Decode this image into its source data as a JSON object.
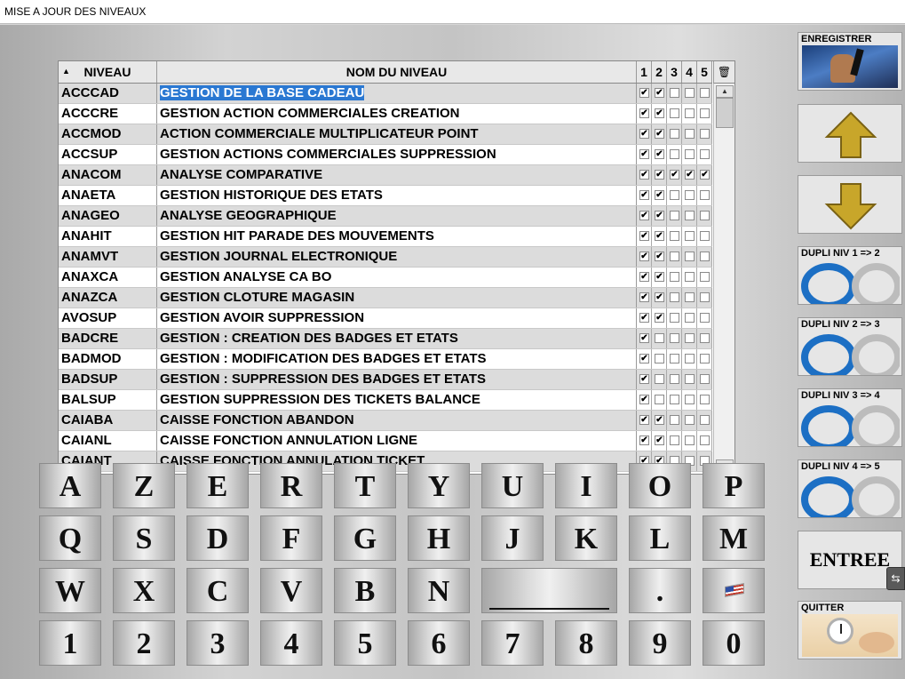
{
  "window": {
    "title": "MISE A JOUR DES NIVEAUX"
  },
  "grid": {
    "headers": {
      "code": "NIVEAU",
      "name": "NOM DU NIVEAU",
      "levels": [
        "1",
        "2",
        "3",
        "4",
        "5"
      ]
    },
    "rows": [
      {
        "code": "ACCCAD",
        "name": "GESTION DE LA BASE CADEAU",
        "checks": [
          true,
          true,
          false,
          false,
          false
        ],
        "selected": true
      },
      {
        "code": "ACCCRE",
        "name": "GESTION ACTION COMMERCIALES  CREATION",
        "checks": [
          true,
          true,
          false,
          false,
          false
        ]
      },
      {
        "code": "ACCMOD",
        "name": "ACTION COMMERCIALE MULTIPLICATEUR POINT",
        "checks": [
          true,
          true,
          false,
          false,
          false
        ]
      },
      {
        "code": "ACCSUP",
        "name": "GESTION ACTIONS COMMERCIALES SUPPRESSION",
        "checks": [
          true,
          true,
          false,
          false,
          false
        ]
      },
      {
        "code": "ANACOM",
        "name": "ANALYSE COMPARATIVE",
        "checks": [
          true,
          true,
          true,
          true,
          true
        ]
      },
      {
        "code": "ANAETA",
        "name": "GESTION HISTORIQUE DES ETATS",
        "checks": [
          true,
          true,
          false,
          false,
          false
        ]
      },
      {
        "code": "ANAGEO",
        "name": "ANALYSE GEOGRAPHIQUE",
        "checks": [
          true,
          true,
          false,
          false,
          false
        ]
      },
      {
        "code": "ANAHIT",
        "name": "GESTION HIT PARADE DES MOUVEMENTS",
        "checks": [
          true,
          true,
          false,
          false,
          false
        ]
      },
      {
        "code": "ANAMVT",
        "name": "GESTION JOURNAL ELECTRONIQUE",
        "checks": [
          true,
          true,
          false,
          false,
          false
        ]
      },
      {
        "code": "ANAXCA",
        "name": "GESTION ANALYSE CA BO",
        "checks": [
          true,
          true,
          false,
          false,
          false
        ]
      },
      {
        "code": "ANAZCA",
        "name": "GESTION CLOTURE MAGASIN",
        "checks": [
          true,
          true,
          false,
          false,
          false
        ]
      },
      {
        "code": "AVOSUP",
        "name": "GESTION AVOIR SUPPRESSION",
        "checks": [
          true,
          true,
          false,
          false,
          false
        ]
      },
      {
        "code": "BADCRE",
        "name": "GESTION : CREATION DES BADGES ET ETATS",
        "checks": [
          true,
          false,
          false,
          false,
          false
        ]
      },
      {
        "code": "BADMOD",
        "name": "GESTION : MODIFICATION DES BADGES ET ETATS",
        "checks": [
          true,
          false,
          false,
          false,
          false
        ]
      },
      {
        "code": "BADSUP",
        "name": "GESTION : SUPPRESSION DES BADGES ET ETATS",
        "checks": [
          true,
          false,
          false,
          false,
          false
        ]
      },
      {
        "code": "BALSUP",
        "name": "GESTION SUPPRESSION DES TICKETS BALANCE",
        "checks": [
          true,
          false,
          false,
          false,
          false
        ]
      },
      {
        "code": "CAIABA",
        "name": "CAISSE FONCTION ABANDON",
        "checks": [
          true,
          true,
          false,
          false,
          false
        ]
      },
      {
        "code": "CAIANL",
        "name": "CAISSE FONCTION ANNULATION LIGNE",
        "checks": [
          true,
          true,
          false,
          false,
          false
        ]
      },
      {
        "code": "CAIANT",
        "name": "CAISSE FONCTION ANNULATION TICKET",
        "checks": [
          true,
          true,
          false,
          false,
          false
        ]
      }
    ]
  },
  "keyboard": {
    "row1": [
      "A",
      "Z",
      "E",
      "R",
      "T",
      "Y",
      "U",
      "I",
      "O",
      "P"
    ],
    "row2": [
      "Q",
      "S",
      "D",
      "F",
      "G",
      "H",
      "J",
      "K",
      "L",
      "M"
    ],
    "row3": [
      "W",
      "X",
      "C",
      "V",
      "B",
      "N"
    ],
    "dot": ".",
    "row4": [
      "1",
      "2",
      "3",
      "4",
      "5",
      "6",
      "7",
      "8",
      "9",
      "0"
    ]
  },
  "side": {
    "save": "ENREGISTRER",
    "dupli12": "DUPLI NIV 1 => 2",
    "dupli23": "DUPLI NIV 2 => 3",
    "dupli34": "DUPLI NIV 3 => 4",
    "dupli45": "DUPLI NIV 4 => 5",
    "enter": "ENTREE",
    "quit": "QUITTER"
  },
  "colors": {
    "selection": "#2a78d2",
    "arrow": "#c8a62a"
  },
  "icons": {
    "save": "pen-hand-icon",
    "up": "arrow-up-icon",
    "down": "arrow-down-icon",
    "dupli": "level-rings-icon",
    "quit": "alarm-clock-icon",
    "language": "us-flag-icon"
  }
}
